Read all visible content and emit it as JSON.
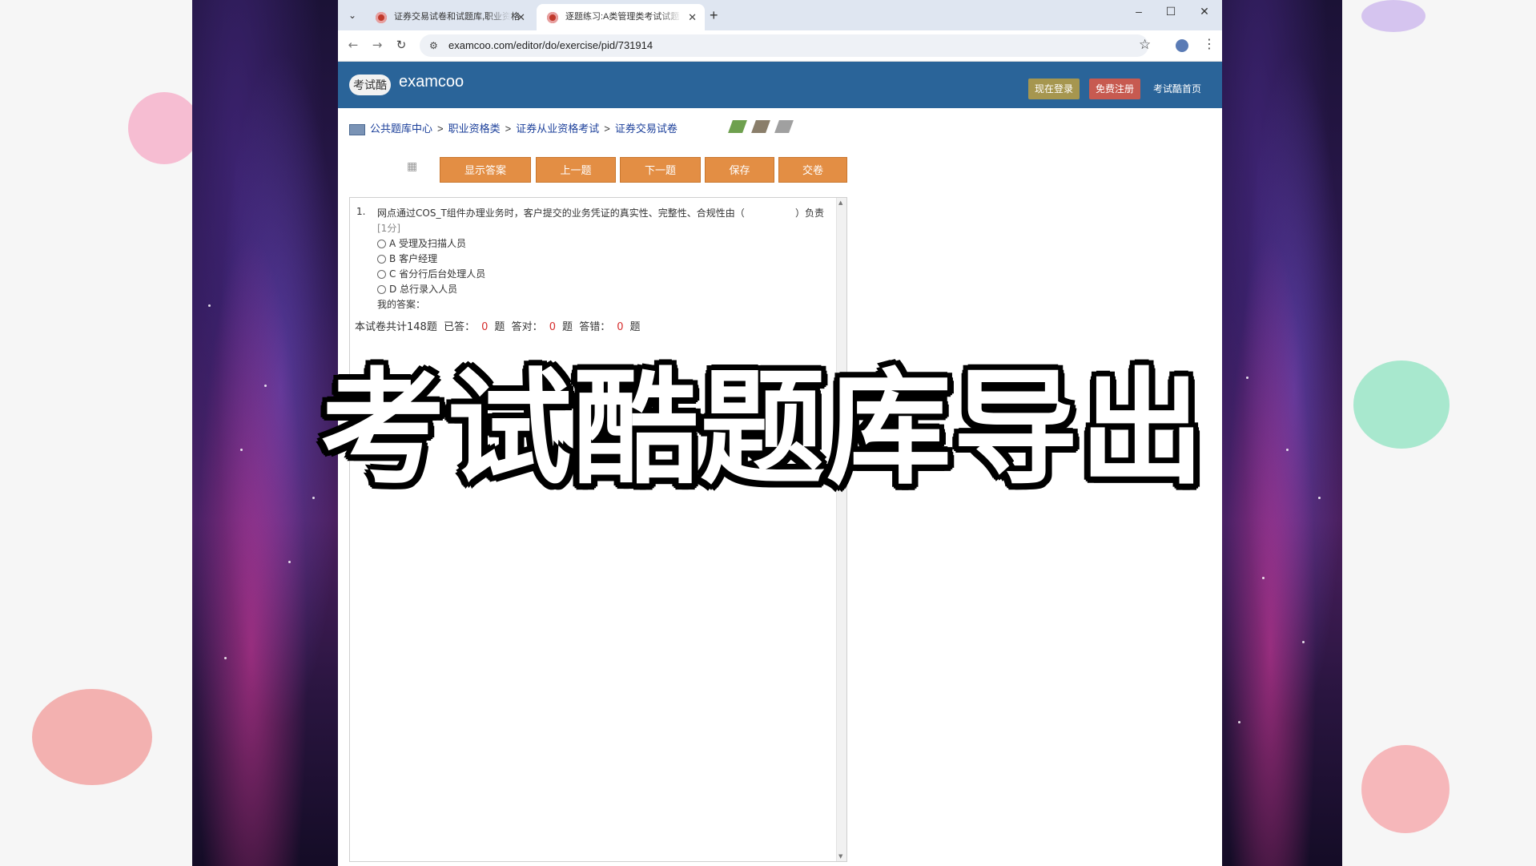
{
  "browser": {
    "tabs": [
      {
        "title": "证券交易试卷和试题库,职业资格",
        "active": false
      },
      {
        "title": "逐题练习:A类管理类考试试题",
        "active": true
      }
    ],
    "url": "examcoo.com/editor/do/exercise/pid/731914"
  },
  "site": {
    "logo_badge": "考试酷",
    "logo_text": "examcoo",
    "login_label": "现在登录",
    "register_label": "免费注册",
    "home_label": "考试酷首页"
  },
  "breadcrumb": [
    "公共题库中心",
    "职业资格类",
    "证券从业资格考试",
    "证券交易试卷"
  ],
  "breadcrumb_separator": ">",
  "toolbar": {
    "show_answer": "显示答案",
    "prev": "上一题",
    "next": "下一题",
    "save": "保存",
    "submit": "交卷"
  },
  "question": {
    "number": "1.",
    "text": "网点通过COS_T组件办理业务时，客户提交的业务凭证的真实性、完整性、合规性由（",
    "tail": "）负责",
    "score": "[1分]",
    "options": [
      {
        "letter": "A",
        "text": "受理及扫描人员"
      },
      {
        "letter": "B",
        "text": "客户经理"
      },
      {
        "letter": "C",
        "text": "省分行后台处理人员"
      },
      {
        "letter": "D",
        "text": "总行录入人员"
      }
    ],
    "my_answer_label": "我的答案："
  },
  "summary": {
    "total_label": "本试卷共计148题",
    "answered_label": "已答：",
    "answered": "0",
    "correct_label": "答对：",
    "correct": "0",
    "wrong_label": "答错：",
    "wrong": "0",
    "unit": "题"
  },
  "caption": "考试酷题库导出",
  "colors": {
    "header": "#2a6499",
    "toolbar_button": "#e38e44",
    "login_button": "#a6964f",
    "register_button": "#c75a50",
    "link": "#1b3f9a",
    "count_red": "#d62d2d"
  }
}
